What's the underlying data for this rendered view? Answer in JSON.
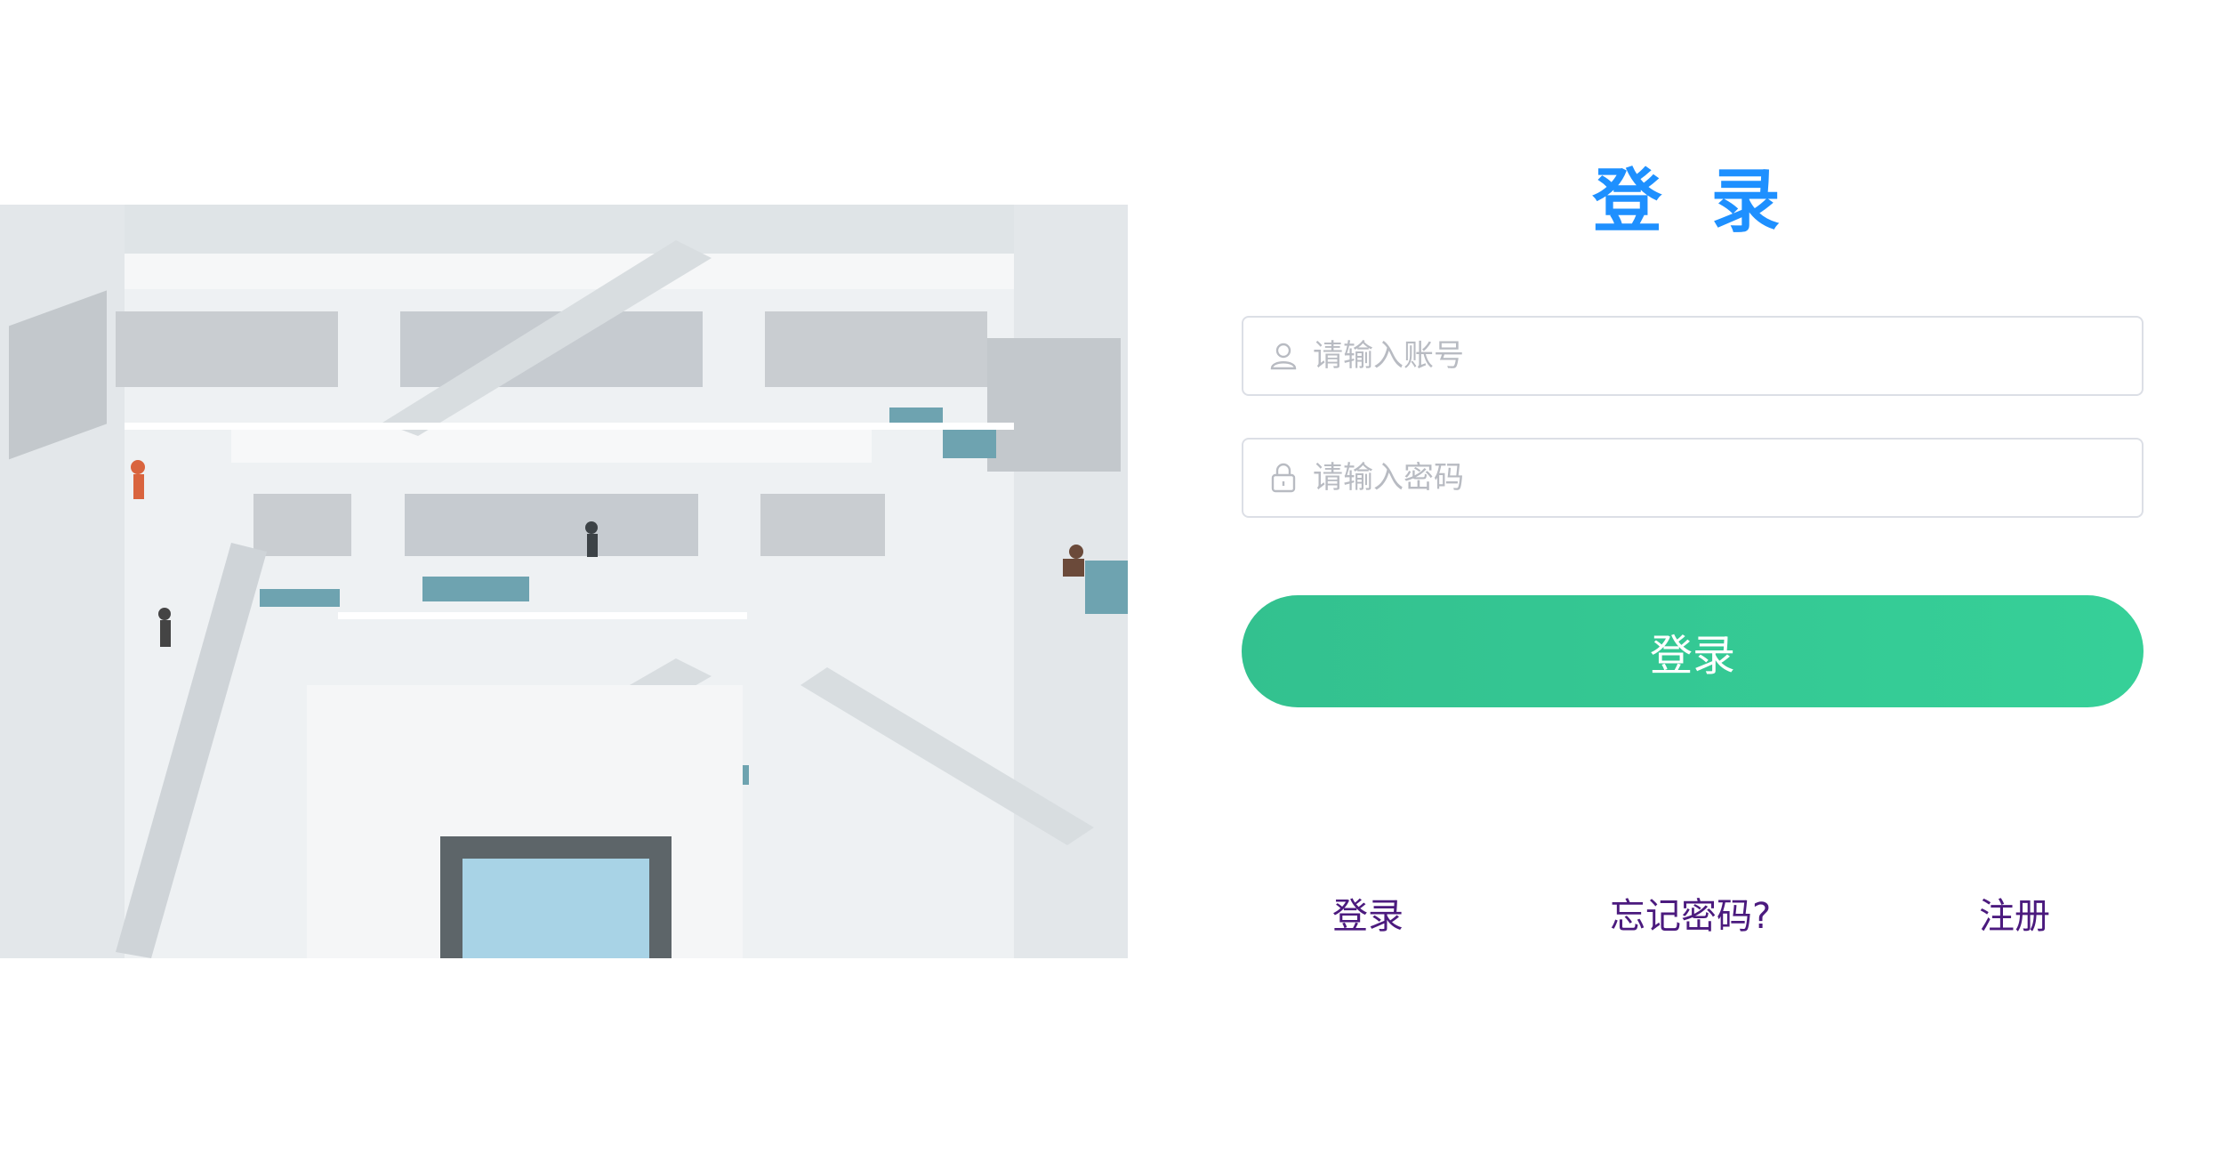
{
  "login_form": {
    "title": "登 录",
    "username_placeholder": "请输入账号",
    "password_placeholder": "请输入密码",
    "submit_label": "登录"
  },
  "footer_links": {
    "login": "登录",
    "forgot_password": "忘记密码?",
    "register": "注册"
  },
  "colors": {
    "title": "#1e90ff",
    "button_start": "#33c18f",
    "button_end": "#36d098",
    "link": "#4b1a7e",
    "placeholder": "#b8bbc2",
    "field_border": "#dcdfe6"
  },
  "icons": {
    "username": "user-icon",
    "password": "lock-icon"
  },
  "image": {
    "alt": "library interior photo"
  }
}
